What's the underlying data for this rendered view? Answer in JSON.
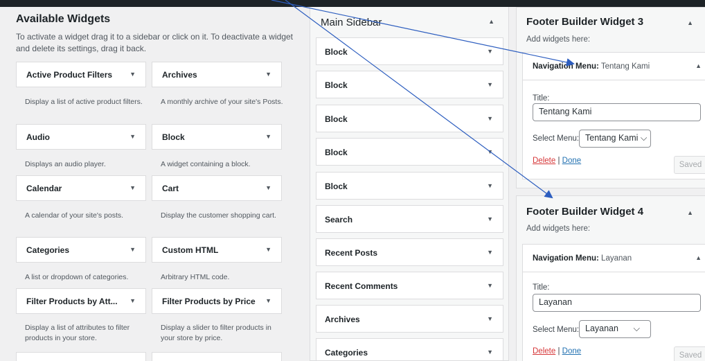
{
  "available": {
    "title": "Available Widgets",
    "description": "To activate a widget drag it to a sidebar or click on it. To deactivate a widget and delete its settings, drag it back.",
    "widgets": [
      {
        "name": "Active Product Filters",
        "desc": "Display a list of active product filters."
      },
      {
        "name": "Archives",
        "desc": "A monthly archive of your site's Posts."
      },
      {
        "name": "Audio",
        "desc": "Displays an audio player."
      },
      {
        "name": "Block",
        "desc": "A widget containing a block."
      },
      {
        "name": "Calendar",
        "desc": "A calendar of your site's posts."
      },
      {
        "name": "Cart",
        "desc": "Display the customer shopping cart."
      },
      {
        "name": "Categories",
        "desc": "A list or dropdown of categories."
      },
      {
        "name": "Custom HTML",
        "desc": "Arbitrary HTML code."
      },
      {
        "name": "Filter Products by Att...",
        "desc": "Display a list of attributes to filter products in your store."
      },
      {
        "name": "Filter Products by Price",
        "desc": "Display a slider to filter products in your store by price."
      }
    ]
  },
  "main_sidebar": {
    "title": "Main Sidebar",
    "widgets": [
      "Block",
      "Block",
      "Block",
      "Block",
      "Block",
      "Search",
      "Recent Posts",
      "Recent Comments",
      "Archives",
      "Categories"
    ]
  },
  "footer3": {
    "title": "Footer Builder Widget 3",
    "hint": "Add widgets here:",
    "nav": {
      "prefix": "Navigation Menu:",
      "name": "Tentang Kami",
      "title_label": "Title:",
      "title_value": "Tentang Kami",
      "select_label": "Select Menu:",
      "select_value": "Tentang Kami",
      "delete": "Delete",
      "sep": "|",
      "done": "Done",
      "saved": "Saved"
    }
  },
  "footer4": {
    "title": "Footer Builder Widget 4",
    "hint": "Add widgets here:",
    "nav": {
      "prefix": "Navigation Menu:",
      "name": "Layanan",
      "title_label": "Title:",
      "title_value": "Layanan",
      "select_label": "Select Menu:",
      "select_value": "Layanan",
      "delete": "Delete",
      "sep": "|",
      "done": "Done",
      "saved": "Saved"
    }
  },
  "icons": {
    "collapse": "triangle-down-icon",
    "expand": "triangle-up-icon"
  },
  "colors": {
    "link": "#2271b1",
    "delete": "#d63638",
    "annotation": "#2c5dbf"
  }
}
